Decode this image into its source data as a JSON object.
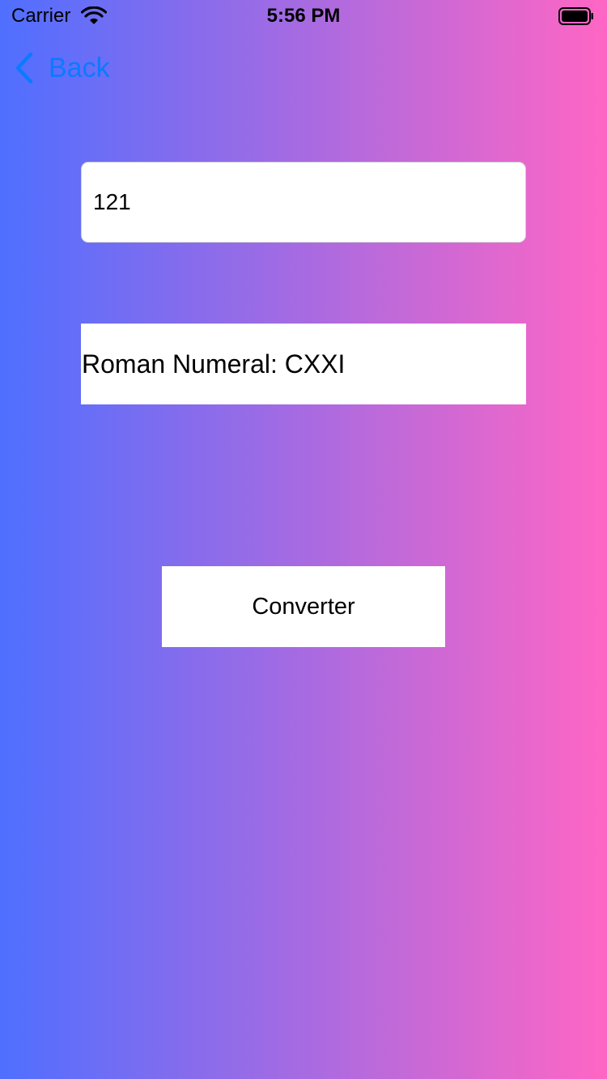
{
  "status_bar": {
    "carrier": "Carrier",
    "time": "5:56 PM",
    "wifi_icon": "wifi-icon",
    "battery_icon": "battery-icon"
  },
  "nav": {
    "back_label": "Back",
    "back_icon": "chevron-left-icon",
    "tint_color": "#0a7bff"
  },
  "form": {
    "number_value": "121",
    "result_text": "Roman Numeral: CXXI",
    "convert_label": "Converter"
  },
  "theme": {
    "gradient_start": "#4f6fff",
    "gradient_end": "#ff66c4"
  }
}
